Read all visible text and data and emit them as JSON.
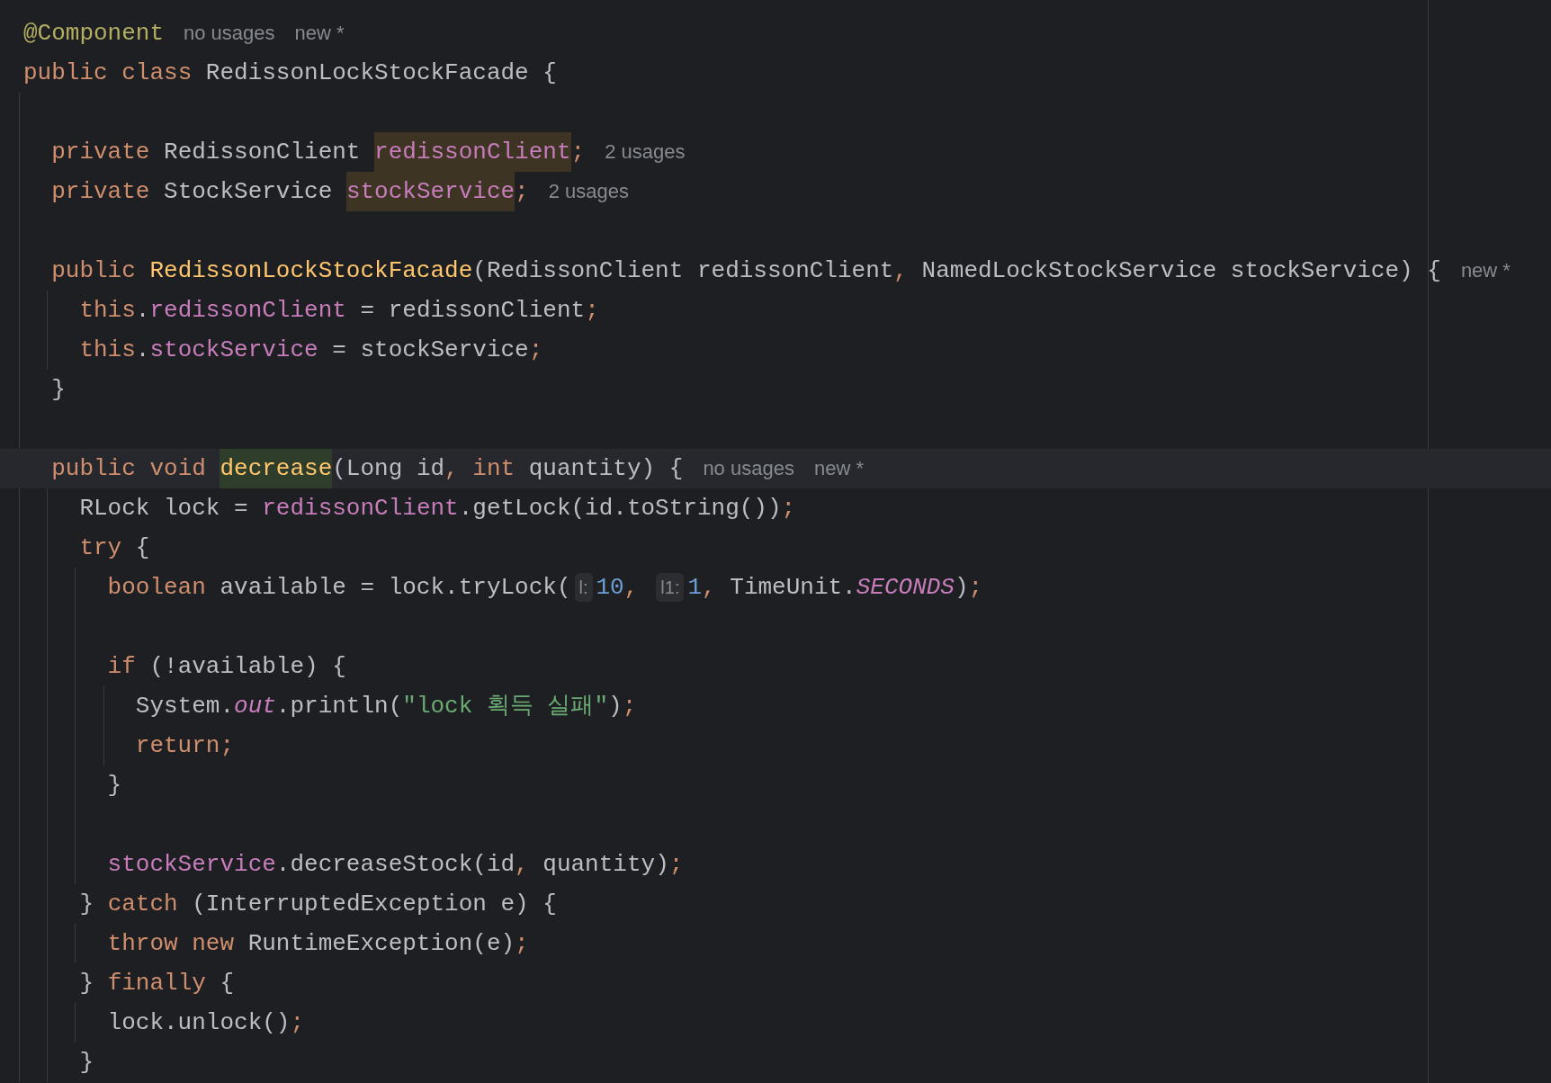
{
  "lines": [
    {
      "kind": "code",
      "current": false,
      "tokens": [
        {
          "kind": "ann",
          "text": "@Component"
        },
        {
          "kind": "hint",
          "text": "no usages"
        },
        {
          "kind": "hint",
          "text": "new *"
        }
      ]
    },
    {
      "kind": "code",
      "current": false,
      "tokens": [
        {
          "kind": "kw",
          "text": "public class "
        },
        {
          "kind": "text",
          "text": "RedissonLockStockFacade {"
        }
      ],
      "children": [
        {
          "kind": "blank"
        },
        {
          "kind": "code",
          "current": false,
          "tokens": [
            {
              "kind": "kw",
              "text": "private "
            },
            {
              "kind": "text",
              "text": "RedissonClient "
            },
            {
              "kind": "field",
              "text": "redissonClient",
              "highlighted": true
            },
            {
              "kind": "punct",
              "text": ";"
            },
            {
              "kind": "hint",
              "text": "2 usages"
            }
          ]
        },
        {
          "kind": "code",
          "current": false,
          "tokens": [
            {
              "kind": "kw",
              "text": "private "
            },
            {
              "kind": "text",
              "text": "StockService "
            },
            {
              "kind": "field",
              "text": "stockService",
              "highlighted": true
            },
            {
              "kind": "punct",
              "text": ";"
            },
            {
              "kind": "hint",
              "text": "2 usages"
            }
          ]
        },
        {
          "kind": "blank"
        },
        {
          "kind": "code",
          "current": false,
          "tokens": [
            {
              "kind": "kw",
              "text": "public "
            },
            {
              "kind": "decl",
              "text": "RedissonLockStockFacade"
            },
            {
              "kind": "text",
              "text": "(RedissonClient redissonClient"
            },
            {
              "kind": "punct",
              "text": ", "
            },
            {
              "kind": "text",
              "text": "NamedLockStockService stockService) {"
            },
            {
              "kind": "hint",
              "text": "new *"
            }
          ],
          "children": [
            {
              "kind": "code",
              "current": false,
              "tokens": [
                {
                  "kind": "kw",
                  "text": "this"
                },
                {
                  "kind": "text",
                  "text": "."
                },
                {
                  "kind": "field",
                  "text": "redissonClient"
                },
                {
                  "kind": "text",
                  "text": " = redissonClient"
                },
                {
                  "kind": "punct",
                  "text": ";"
                }
              ]
            },
            {
              "kind": "code",
              "current": false,
              "tokens": [
                {
                  "kind": "kw",
                  "text": "this"
                },
                {
                  "kind": "text",
                  "text": "."
                },
                {
                  "kind": "field",
                  "text": "stockService"
                },
                {
                  "kind": "text",
                  "text": " = stockService"
                },
                {
                  "kind": "punct",
                  "text": ";"
                }
              ]
            }
          ]
        },
        {
          "kind": "code",
          "current": false,
          "tokens": [
            {
              "kind": "text",
              "text": "}"
            }
          ]
        },
        {
          "kind": "blank"
        },
        {
          "kind": "code",
          "current": true,
          "tokens": [
            {
              "kind": "kw",
              "text": "public void "
            },
            {
              "kind": "decl",
              "text": "decrease",
              "highlighted": true
            },
            {
              "kind": "text",
              "text": "(Long id"
            },
            {
              "kind": "punct",
              "text": ", "
            },
            {
              "kind": "kw",
              "text": "int "
            },
            {
              "kind": "text",
              "text": "quantity) {"
            },
            {
              "kind": "hint",
              "text": "no usages"
            },
            {
              "kind": "hint",
              "text": "new *"
            }
          ],
          "children": [
            {
              "kind": "code",
              "current": false,
              "tokens": [
                {
                  "kind": "text",
                  "text": "RLock lock = "
                },
                {
                  "kind": "field",
                  "text": "redissonClient"
                },
                {
                  "kind": "text",
                  "text": ".getLock(id.toString())"
                },
                {
                  "kind": "punct",
                  "text": ";"
                }
              ]
            },
            {
              "kind": "code",
              "current": false,
              "tokens": [
                {
                  "kind": "kw",
                  "text": "try "
                },
                {
                  "kind": "text",
                  "text": "{"
                }
              ],
              "children": [
                {
                  "kind": "code",
                  "current": false,
                  "tokens": [
                    {
                      "kind": "kw",
                      "text": "boolean "
                    },
                    {
                      "kind": "text",
                      "text": "available = lock.tryLock("
                    },
                    {
                      "kind": "param",
                      "text": "l:"
                    },
                    {
                      "kind": "num",
                      "text": "10"
                    },
                    {
                      "kind": "punct",
                      "text": ","
                    },
                    {
                      "kind": "param",
                      "text": "l1:"
                    },
                    {
                      "kind": "num",
                      "text": "1"
                    },
                    {
                      "kind": "punct",
                      "text": ", "
                    },
                    {
                      "kind": "text",
                      "text": "TimeUnit."
                    },
                    {
                      "kind": "static",
                      "text": "SECONDS"
                    },
                    {
                      "kind": "text",
                      "text": ")"
                    },
                    {
                      "kind": "punct",
                      "text": ";"
                    }
                  ]
                },
                {
                  "kind": "blank"
                },
                {
                  "kind": "code",
                  "current": false,
                  "tokens": [
                    {
                      "kind": "kw",
                      "text": "if "
                    },
                    {
                      "kind": "text",
                      "text": "(!available) {"
                    }
                  ],
                  "children": [
                    {
                      "kind": "code",
                      "current": false,
                      "tokens": [
                        {
                          "kind": "text",
                          "text": "System."
                        },
                        {
                          "kind": "static",
                          "text": "out"
                        },
                        {
                          "kind": "text",
                          "text": ".println("
                        },
                        {
                          "kind": "str",
                          "text": "\"lock 획득 실패\""
                        },
                        {
                          "kind": "text",
                          "text": ")"
                        },
                        {
                          "kind": "punct",
                          "text": ";"
                        }
                      ]
                    },
                    {
                      "kind": "code",
                      "current": false,
                      "tokens": [
                        {
                          "kind": "kw",
                          "text": "return;"
                        }
                      ]
                    }
                  ]
                },
                {
                  "kind": "code",
                  "current": false,
                  "tokens": [
                    {
                      "kind": "text",
                      "text": "}"
                    }
                  ]
                },
                {
                  "kind": "blank"
                },
                {
                  "kind": "code",
                  "current": false,
                  "tokens": [
                    {
                      "kind": "field",
                      "text": "stockService"
                    },
                    {
                      "kind": "text",
                      "text": ".decreaseStock(id"
                    },
                    {
                      "kind": "punct",
                      "text": ", "
                    },
                    {
                      "kind": "text",
                      "text": "quantity)"
                    },
                    {
                      "kind": "punct",
                      "text": ";"
                    }
                  ]
                }
              ]
            },
            {
              "kind": "code",
              "current": false,
              "tokens": [
                {
                  "kind": "text",
                  "text": "} "
                },
                {
                  "kind": "kw",
                  "text": "catch "
                },
                {
                  "kind": "text",
                  "text": "(InterruptedException e) {"
                }
              ],
              "children": [
                {
                  "kind": "code",
                  "current": false,
                  "tokens": [
                    {
                      "kind": "kw",
                      "text": "throw new "
                    },
                    {
                      "kind": "text",
                      "text": "RuntimeException(e)"
                    },
                    {
                      "kind": "punct",
                      "text": ";"
                    }
                  ]
                }
              ]
            },
            {
              "kind": "code",
              "current": false,
              "tokens": [
                {
                  "kind": "text",
                  "text": "} "
                },
                {
                  "kind": "kw",
                  "text": "finally "
                },
                {
                  "kind": "text",
                  "text": "{"
                }
              ],
              "children": [
                {
                  "kind": "code",
                  "current": false,
                  "tokens": [
                    {
                      "kind": "text",
                      "text": "lock.unlock()"
                    },
                    {
                      "kind": "punct",
                      "text": ";"
                    }
                  ]
                }
              ]
            },
            {
              "kind": "code",
              "current": false,
              "tokens": [
                {
                  "kind": "text",
                  "text": "}"
                }
              ]
            }
          ]
        }
      ]
    }
  ]
}
